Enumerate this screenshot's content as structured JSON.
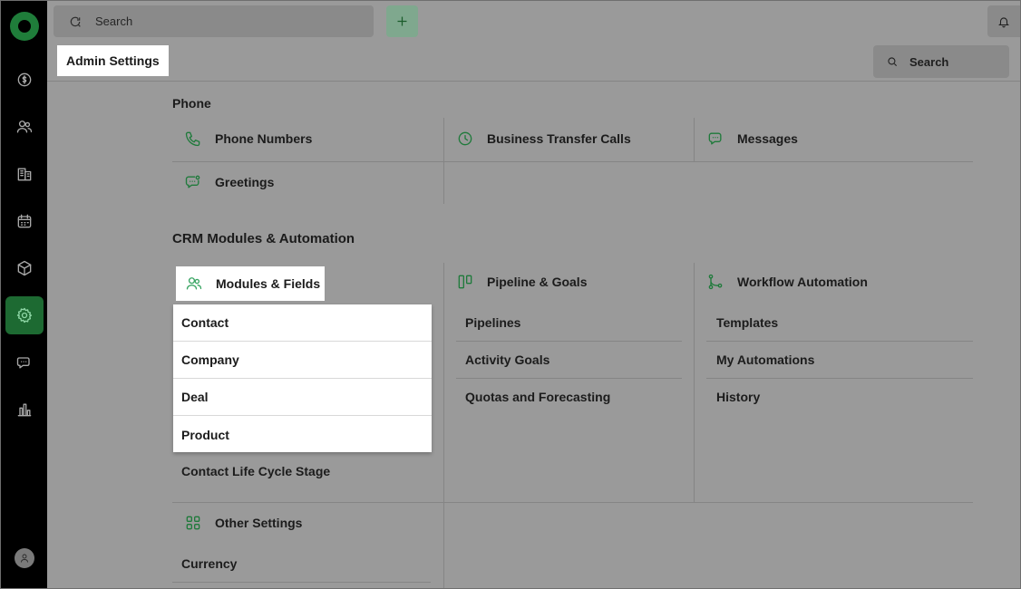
{
  "topbar": {
    "search_placeholder": "Search"
  },
  "header": {
    "title": "Admin Settings",
    "search_label": "Search"
  },
  "rail": {
    "items": [
      {
        "icon": "dollar-icon"
      },
      {
        "icon": "users-icon"
      },
      {
        "icon": "building-icon"
      },
      {
        "icon": "calendar-icon"
      },
      {
        "icon": "box-icon"
      },
      {
        "icon": "gear-icon",
        "active": true
      },
      {
        "icon": "chat-icon"
      },
      {
        "icon": "bar-chart-icon"
      }
    ]
  },
  "phone": {
    "title": "Phone",
    "phone_numbers": "Phone Numbers",
    "business_transfer": "Business Transfer Calls",
    "messages": "Messages",
    "greetings": "Greetings"
  },
  "crm": {
    "title": "CRM Modules & Automation",
    "modules_fields": "Modules & Fields",
    "modules_dropdown": [
      "Contact",
      "Company",
      "Deal",
      "Product"
    ],
    "contact_lifecycle": "Contact Life Cycle Stage",
    "pipeline_goals": "Pipeline & Goals",
    "pipeline_links": [
      "Pipelines",
      "Activity Goals",
      "Quotas and Forecasting"
    ],
    "workflow": "Workflow Automation",
    "workflow_links": [
      "Templates",
      "My Automations",
      "History"
    ]
  },
  "other": {
    "title": "Other Settings",
    "currency": "Currency"
  },
  "colors": {
    "accent": "#1f7a3b",
    "rail_bg": "#000000",
    "overlay_bg": "#9a9a9a"
  }
}
